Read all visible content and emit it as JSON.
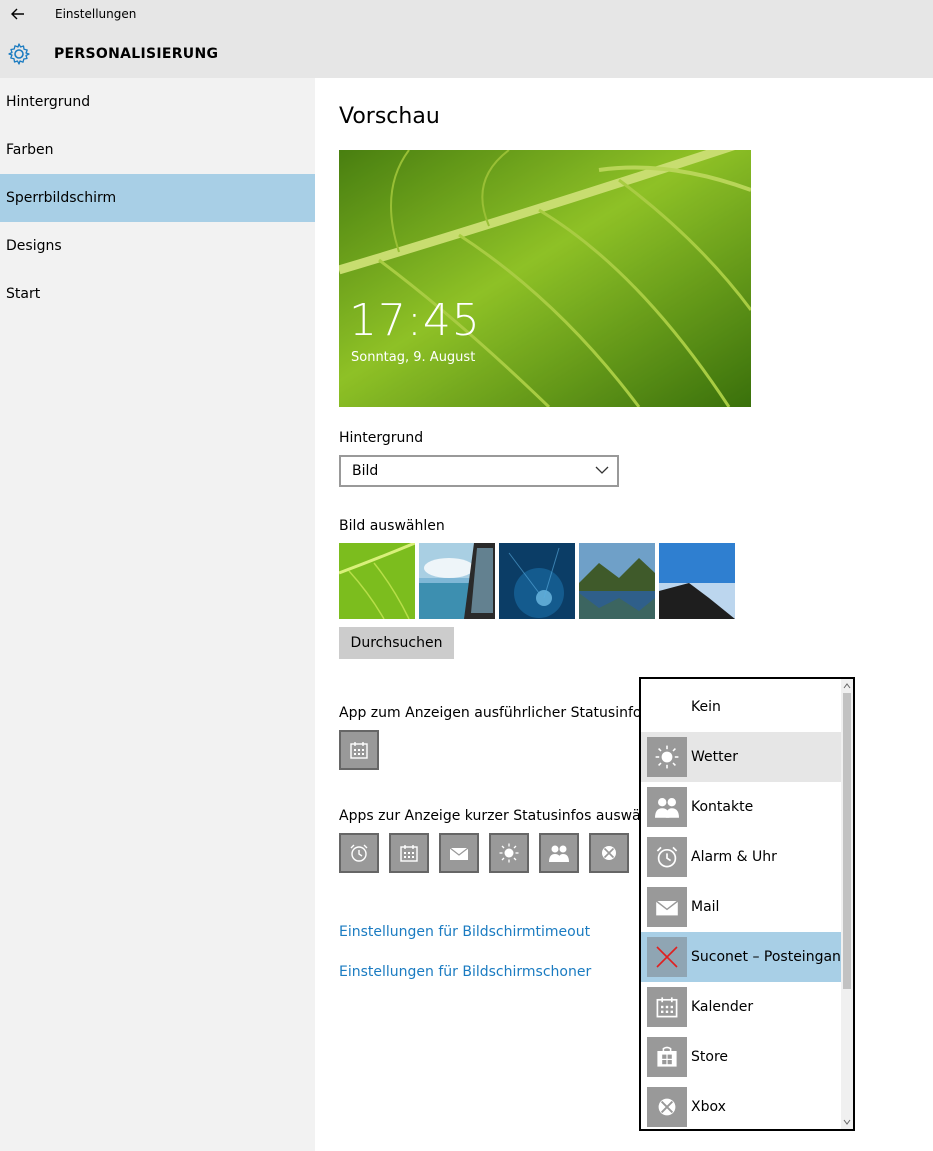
{
  "window": {
    "title": "Einstellungen"
  },
  "header": {
    "page_title": "PERSONALISIERUNG"
  },
  "sidebar": {
    "items": [
      {
        "label": "Hintergrund"
      },
      {
        "label": "Farben"
      },
      {
        "label": "Sperrbildschirm"
      },
      {
        "label": "Designs"
      },
      {
        "label": "Start"
      }
    ],
    "active_index": 2
  },
  "main": {
    "section_title": "Vorschau",
    "preview": {
      "time": "17:45",
      "date": "Sonntag, 9. August"
    },
    "background_label": "Hintergrund",
    "background_value": "Bild",
    "choose_image_label": "Bild auswählen",
    "browse_label": "Durchsuchen",
    "detailed_status_label": "App zum Anzeigen ausführlicher Statusinfos a",
    "quick_status_label": "Apps zur Anzeige kurzer Statusinfos auswähle",
    "link_timeout": "Einstellungen für Bildschirmtimeout",
    "link_screensaver": "Einstellungen für Bildschirmschoner"
  },
  "popup": {
    "items": [
      {
        "label": "Kein",
        "icon": "none"
      },
      {
        "label": "Wetter",
        "icon": "sun-icon"
      },
      {
        "label": "Kontakte",
        "icon": "people-icon"
      },
      {
        "label": "Alarm & Uhr",
        "icon": "alarm-clock-icon"
      },
      {
        "label": "Mail",
        "icon": "mail-icon"
      },
      {
        "label": "Suconet – Posteingang",
        "icon": "x-icon"
      },
      {
        "label": "Kalender",
        "icon": "calendar-icon"
      },
      {
        "label": "Store",
        "icon": "store-icon"
      },
      {
        "label": "Xbox",
        "icon": "xbox-icon"
      }
    ]
  },
  "colors": {
    "accent": "#1a7bc1",
    "selection": "#a8cfe6",
    "tile_gray": "#999999",
    "sidebar_bg": "#f2f2f2",
    "header_bg": "#e6e6e6"
  }
}
